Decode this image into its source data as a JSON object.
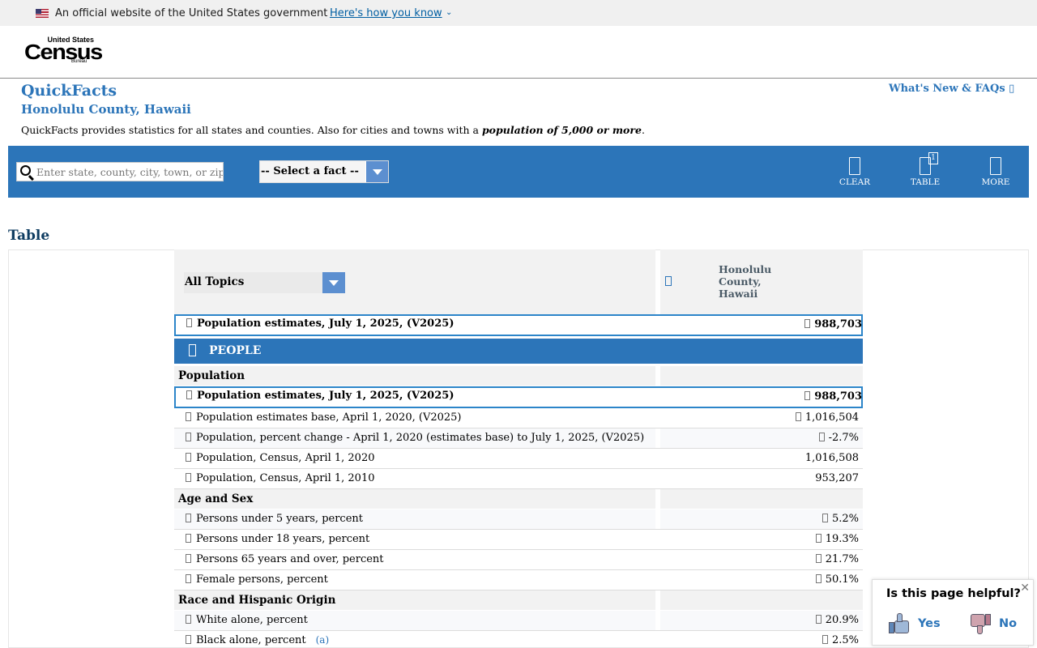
{
  "gov_banner": {
    "text": "An official website of the United States government",
    "link": "Here's how you know"
  },
  "logo": {
    "line1": "United States",
    "line2": "Census",
    "line3": "Bureau"
  },
  "header": {
    "title": "QuickFacts",
    "geography": "Honolulu County, Hawaii",
    "whats_new": "What's New & FAQs",
    "description_prefix": "QuickFacts provides statistics for all states and counties. Also for cities and towns with a ",
    "description_emphasis": "population of 5,000 or more",
    "description_suffix": "."
  },
  "toolbar": {
    "search_placeholder": "Enter state, county, city, town, or zip code",
    "fact_select": "-- Select a fact --",
    "clear": "CLEAR",
    "table": "TABLE",
    "table_badge": "1",
    "more": "MORE"
  },
  "section_title": "Table",
  "table": {
    "topic_select": "All Topics",
    "geo_column": "Honolulu County, Hawaii",
    "top_row": {
      "label": "Population estimates, July 1, 2025, (V2025)",
      "value": "988,703"
    },
    "people_label": "PEOPLE",
    "categories": {
      "population": "Population",
      "age_sex": "Age and Sex",
      "race": "Race and Hispanic Origin"
    },
    "population_rows": [
      {
        "label": "Population estimates, July 1, 2025, (V2025)",
        "value": "988,703"
      },
      {
        "label": "Population estimates base, April 1, 2020, (V2025)",
        "value": "1,016,504"
      },
      {
        "label": "Population, percent change - April 1, 2020 (estimates base) to July 1, 2025, (V2025)",
        "value": "-2.7%"
      },
      {
        "label": "Population, Census, April 1, 2020",
        "value": "1,016,508"
      },
      {
        "label": "Population, Census, April 1, 2010",
        "value": "953,207"
      }
    ],
    "age_sex_rows": [
      {
        "label": "Persons under 5 years, percent",
        "value": "5.2%"
      },
      {
        "label": "Persons under 18 years, percent",
        "value": "19.3%"
      },
      {
        "label": "Persons 65 years and over, percent",
        "value": "21.7%"
      },
      {
        "label": "Female persons, percent",
        "value": "50.1%"
      }
    ],
    "race_rows": [
      {
        "label": "White alone, percent",
        "value": "20.9%"
      },
      {
        "label": "Black alone, percent",
        "value": "2.5%",
        "footnote": "(a)"
      }
    ]
  },
  "feedback": {
    "question": "Is this page helpful?",
    "yes": "Yes",
    "no": "No",
    "close": "✕"
  },
  "colors": {
    "census_blue": "#2c75b9",
    "dark_heading": "#0e3c61",
    "highlight_border": "#2c85c9"
  }
}
